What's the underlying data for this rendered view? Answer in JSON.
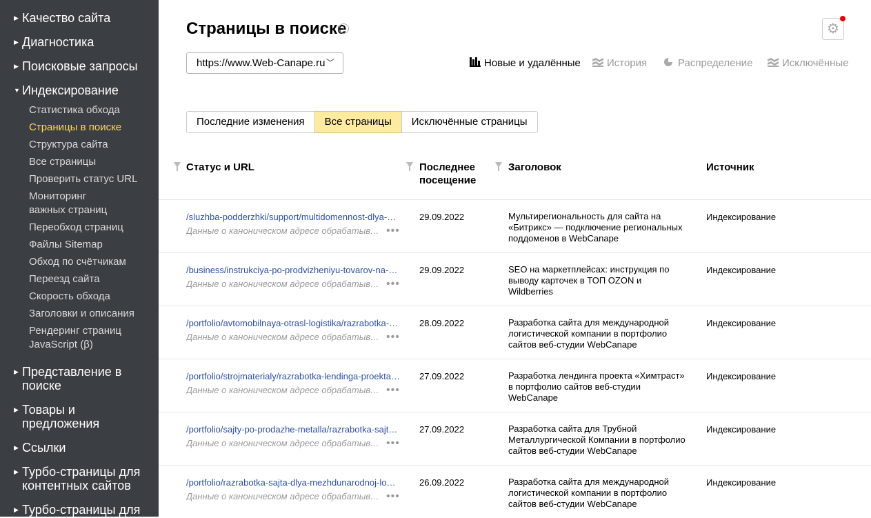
{
  "sidebar": {
    "sections_top": [
      {
        "label": "Качество сайта"
      },
      {
        "label": "Диагностика"
      },
      {
        "label": "Поисковые запросы"
      },
      {
        "label": "Индексирование"
      }
    ],
    "sub_items": [
      {
        "label": "Статистика обхода"
      },
      {
        "label": "Страницы в поиске"
      },
      {
        "label": "Структура сайта"
      },
      {
        "label": "Все страницы"
      },
      {
        "label": "Проверить статус URL"
      },
      {
        "label": "Мониторинг важных страниц"
      },
      {
        "label": "Переобход страниц"
      },
      {
        "label": "Файлы Sitemap"
      },
      {
        "label": "Обход по счётчикам"
      },
      {
        "label": "Переезд сайта"
      },
      {
        "label": "Скорость обхода"
      },
      {
        "label": "Заголовки и описания"
      },
      {
        "label": "Рендеринг страниц JavaScript (β)"
      }
    ],
    "sections_bottom": [
      {
        "label": "Представление в поиске"
      },
      {
        "label": "Товары и предложения"
      },
      {
        "label": "Ссылки"
      },
      {
        "label": "Турбо-страницы для контентных сайтов"
      },
      {
        "label": "Турбо-страницы для"
      }
    ]
  },
  "header": {
    "title": "Страницы в поиске",
    "info_glyph": "i",
    "site": "https://www.Web-Canape.ru"
  },
  "view_tabs": [
    {
      "label": "Новые и удалённые",
      "icon": "bar-chart-icon",
      "active": true
    },
    {
      "label": "История",
      "icon": "history-icon",
      "active": false
    },
    {
      "label": "Распределение",
      "icon": "pie-chart-icon",
      "active": false
    },
    {
      "label": "Исключённые",
      "icon": "excluded-icon",
      "active": false
    }
  ],
  "filters": [
    {
      "label": "Последние изменения",
      "active": false
    },
    {
      "label": "Все страницы",
      "active": true
    },
    {
      "label": "Исключённые страницы",
      "active": false
    }
  ],
  "table": {
    "columns": {
      "status_url": "Статус и URL",
      "last_visit_line1": "Последнее",
      "last_visit_line2": "посещение",
      "title": "Заголовок",
      "source": "Источник"
    },
    "rows": [
      {
        "url": "/sluzhba-podderzhki/support/multidomennost-dlya-saytov-na-bitriks/",
        "canonical": "Данные о каноническом адресе обрабатываются",
        "date": "29.09.2022",
        "title": "Мультирегиональность для сайта на «Битрикс» — подключение региональных поддоменов в WebCanape",
        "source": "Индексирование"
      },
      {
        "url": "/business/instrukciya-po-prodvizheniyu-tovarov-na-marketpleysah/",
        "canonical": "Данные о каноническом адресе обрабатываются",
        "date": "29.09.2022",
        "title": "SEO на маркетплейсах: инструкция по выводу карточек в ТОП OZON и Wildberries",
        "source": "Индексирование"
      },
      {
        "url": "/portfolio/avtomobilnaya-otrasl-logistika/razrabotka-sajta/",
        "canonical": "Данные о каноническом адресе обрабатываются",
        "date": "28.09.2022",
        "title": "Разработка сайта для международной логистической компании в портфолио сайтов веб-студии WebCanape",
        "source": "Индексирование"
      },
      {
        "url": "/portfolio/strojmaterialy/razrabotka-lendinga-proekta-himtrast/",
        "canonical": "Данные о каноническом адресе обрабатываются",
        "date": "27.09.2022",
        "title": "Разработка лендинга проекта «Химтраст» в портфолио сайтов веб-студии WebCanape",
        "source": "Индексирование"
      },
      {
        "url": "/portfolio/sajty-po-prodazhe-metalla/razrabotka-sajta-tmk/",
        "canonical": "Данные о каноническом адресе обрабатываются",
        "date": "27.09.2022",
        "title": "Разработка сайта для Трубной Металлургической Компании в портфолио сайтов веб-студии WebCanape",
        "source": "Индексирование"
      },
      {
        "url": "/portfolio/razrabotka-sajta-dlya-mezhdunarodnoj-logisticheskoj-kompanii/",
        "canonical": "Данные о каноническом адресе обрабатываются",
        "date": "26.09.2022",
        "title": "Разработка сайта для международной логистической компании в портфолио сайтов веб-студии WebCanape",
        "source": "Индексирование"
      }
    ]
  },
  "colors": {
    "sidebar_bg": "#3b3e43",
    "active_nav": "#ffdb4d",
    "link": "#2a4fa5",
    "active_filter_bg": "#ffeba0"
  }
}
